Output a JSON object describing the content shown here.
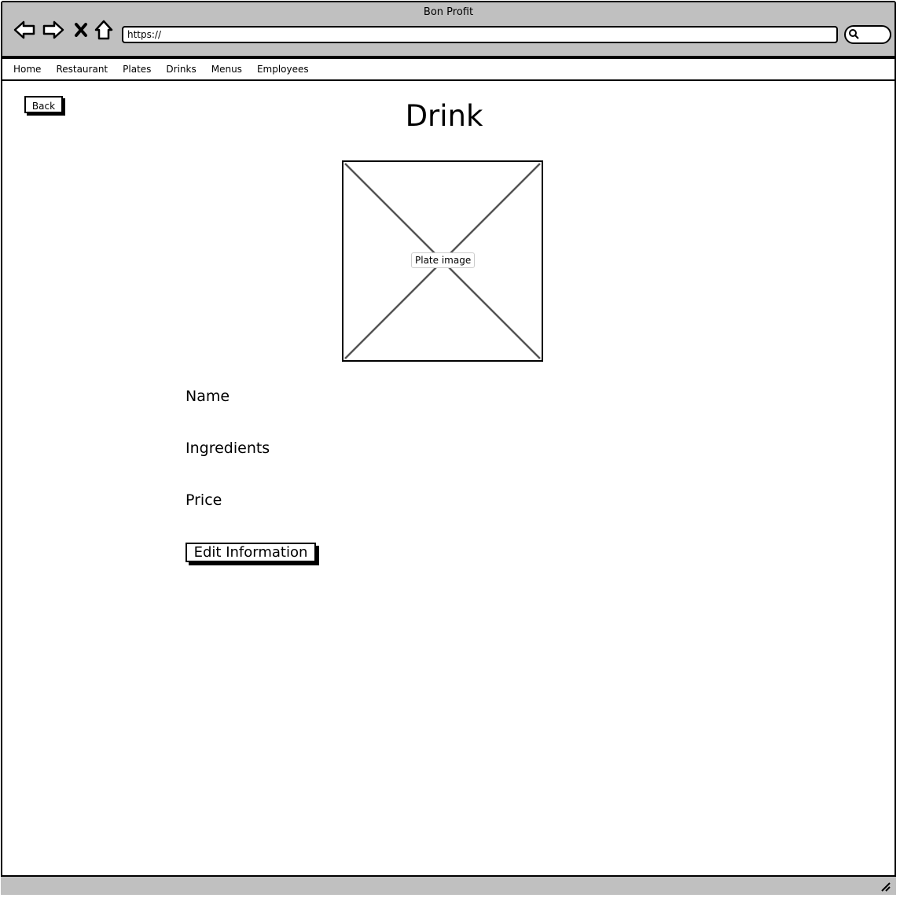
{
  "window": {
    "title": "Bon Profit"
  },
  "browser": {
    "url": "https://",
    "icons": [
      "back-arrow-icon",
      "forward-arrow-icon",
      "stop-icon",
      "home-icon",
      "search-icon"
    ]
  },
  "navbar": {
    "items": [
      {
        "label": "Home"
      },
      {
        "label": "Restaurant"
      },
      {
        "label": "Plates"
      },
      {
        "label": "Drinks"
      },
      {
        "label": "Menus"
      },
      {
        "label": "Employees"
      }
    ]
  },
  "page": {
    "back_label": "Back",
    "title": "Drink",
    "image_label": "Plate image",
    "fields": {
      "name": "Name",
      "ingredients": "Ingredients",
      "price": "Price"
    },
    "edit_label": "Edit Information"
  }
}
